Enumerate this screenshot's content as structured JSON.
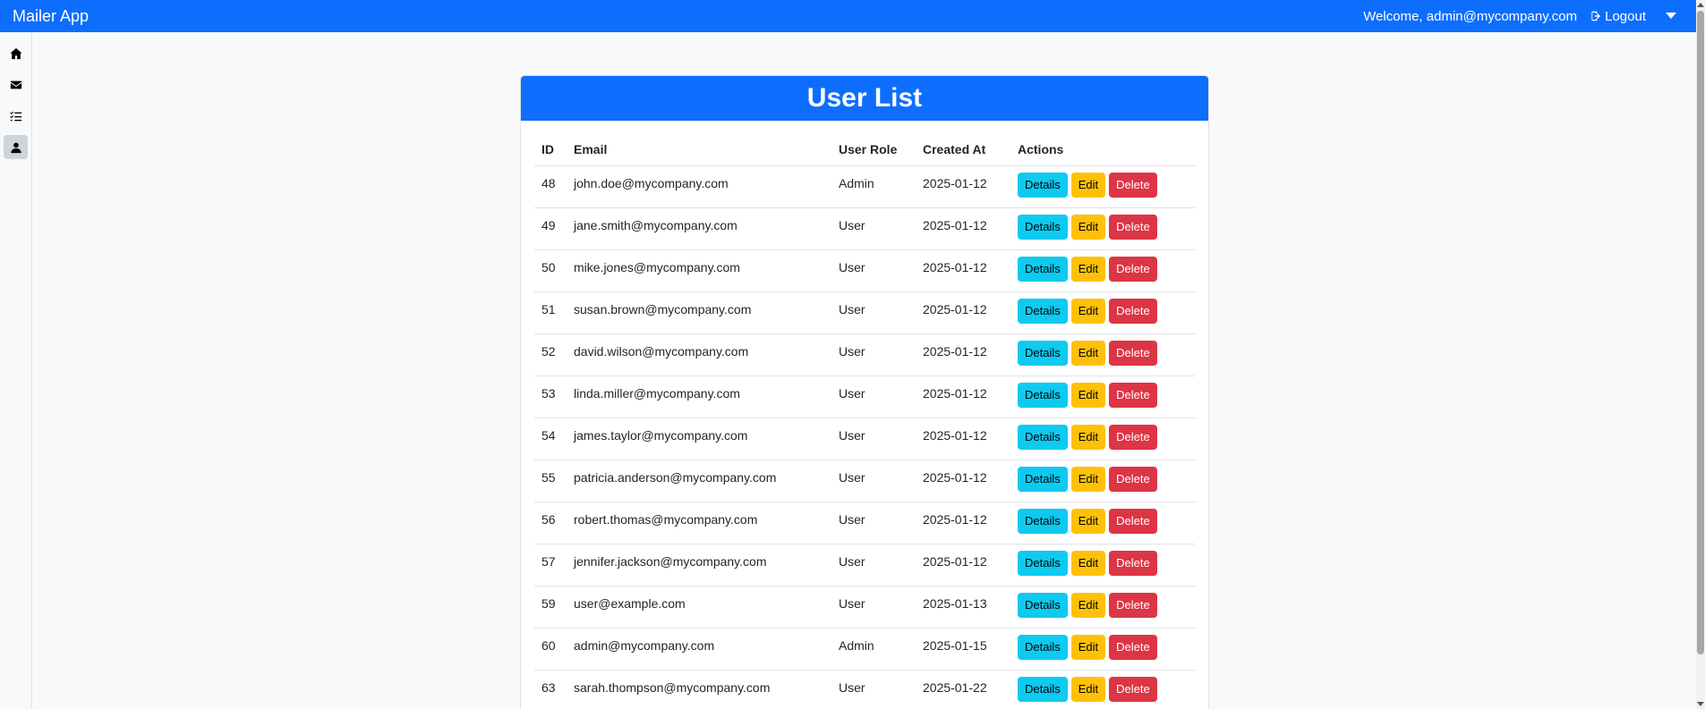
{
  "navbar": {
    "brand": "Mailer App",
    "welcome": "Welcome, admin@mycompany.com",
    "logout_label": "Logout"
  },
  "sidebar": {
    "items": [
      {
        "name": "home",
        "icon": "home-icon",
        "active": false
      },
      {
        "name": "mail",
        "icon": "envelope-icon",
        "active": false
      },
      {
        "name": "tasks",
        "icon": "list-check-icon",
        "active": false
      },
      {
        "name": "users",
        "icon": "user-icon",
        "active": true
      }
    ]
  },
  "card": {
    "title": "User List"
  },
  "table": {
    "headers": [
      "ID",
      "Email",
      "User Role",
      "Created At",
      "Actions"
    ],
    "rows": [
      {
        "id": "48",
        "email": "john.doe@mycompany.com",
        "role": "Admin",
        "created": "2025-01-12"
      },
      {
        "id": "49",
        "email": "jane.smith@mycompany.com",
        "role": "User",
        "created": "2025-01-12"
      },
      {
        "id": "50",
        "email": "mike.jones@mycompany.com",
        "role": "User",
        "created": "2025-01-12"
      },
      {
        "id": "51",
        "email": "susan.brown@mycompany.com",
        "role": "User",
        "created": "2025-01-12"
      },
      {
        "id": "52",
        "email": "david.wilson@mycompany.com",
        "role": "User",
        "created": "2025-01-12"
      },
      {
        "id": "53",
        "email": "linda.miller@mycompany.com",
        "role": "User",
        "created": "2025-01-12"
      },
      {
        "id": "54",
        "email": "james.taylor@mycompany.com",
        "role": "User",
        "created": "2025-01-12"
      },
      {
        "id": "55",
        "email": "patricia.anderson@mycompany.com",
        "role": "User",
        "created": "2025-01-12"
      },
      {
        "id": "56",
        "email": "robert.thomas@mycompany.com",
        "role": "User",
        "created": "2025-01-12"
      },
      {
        "id": "57",
        "email": "jennifer.jackson@mycompany.com",
        "role": "User",
        "created": "2025-01-12"
      },
      {
        "id": "59",
        "email": "user@example.com",
        "role": "User",
        "created": "2025-01-13"
      },
      {
        "id": "60",
        "email": "admin@mycompany.com",
        "role": "Admin",
        "created": "2025-01-15"
      },
      {
        "id": "63",
        "email": "sarah.thompson@mycompany.com",
        "role": "User",
        "created": "2025-01-22"
      }
    ],
    "action_labels": {
      "details": "Details",
      "edit": "Edit",
      "delete": "Delete"
    }
  },
  "colors": {
    "primary": "#0d6efd",
    "info": "#0dcaf0",
    "warning": "#ffc107",
    "danger": "#dc3545"
  }
}
